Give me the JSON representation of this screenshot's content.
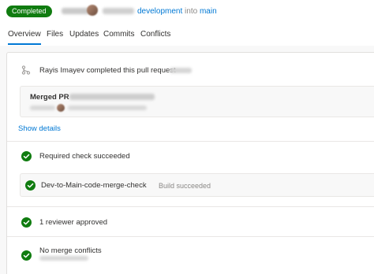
{
  "header": {
    "status_label": "Completed",
    "branch_source": "development",
    "branch_into": "into",
    "branch_target": "main"
  },
  "tabs": [
    {
      "label": "Overview",
      "active": true
    },
    {
      "label": "Files"
    },
    {
      "label": "Updates"
    },
    {
      "label": "Commits"
    },
    {
      "label": "Conflicts"
    }
  ],
  "activity": {
    "completed_text": "Rayis Imayev completed this pull request",
    "merged_title": "Merged PR",
    "show_details": "Show details"
  },
  "checks": {
    "required_check": "Required check succeeded",
    "build_name": "Dev-to-Main-code-merge-check",
    "build_status": "Build succeeded",
    "reviewers": "1 reviewer approved",
    "conflicts": "No merge conflicts"
  },
  "colors": {
    "accent": "#0078d4",
    "success": "#107c10"
  },
  "icons": {
    "merge": "merge-icon",
    "check": "check-circle-icon"
  }
}
